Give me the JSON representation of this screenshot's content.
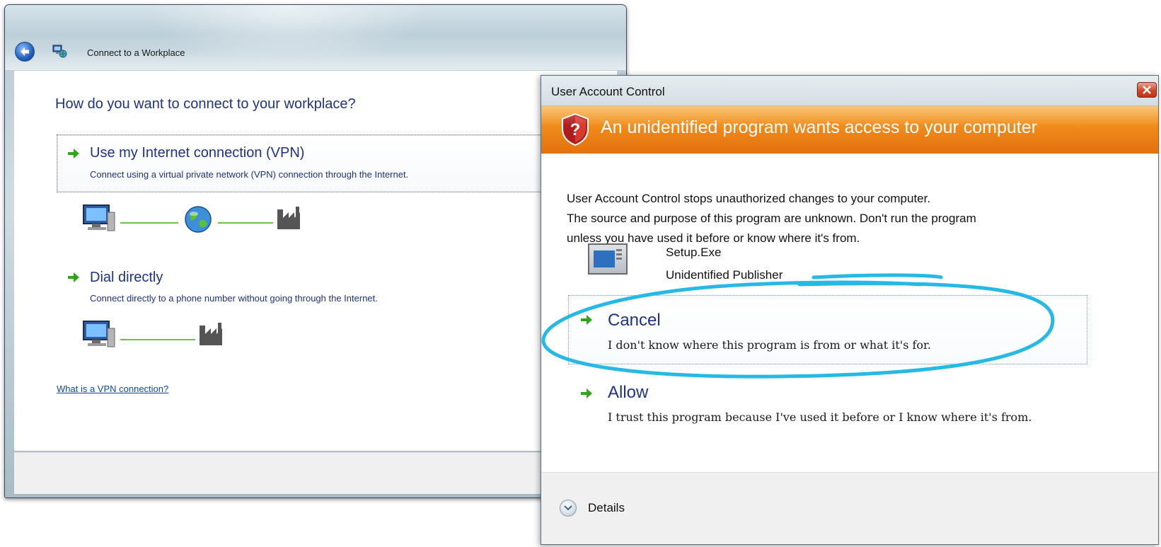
{
  "wizard": {
    "title": "Connect to a Workplace",
    "question": "How do you want to connect to your workplace?",
    "options": [
      {
        "title": "Use my Internet connection (VPN)",
        "description": "Connect using a virtual private network (VPN) connection through the Internet."
      },
      {
        "title": "Dial directly",
        "description": "Connect directly to a phone number without going through the Internet."
      }
    ],
    "help_link": "What is a VPN connection?"
  },
  "uac": {
    "title": "User Account Control",
    "banner": "An unidentified program wants access to your computer",
    "intro_line1": "User Account Control stops unauthorized changes to your computer.",
    "intro_line2": "The source and purpose of this program are unknown.  Don't run the program",
    "intro_line3": "unless you have used it before or know where it's from.",
    "program_name": "Setup.Exe",
    "publisher": "Unidentified Publisher",
    "choices": [
      {
        "title": "Cancel",
        "description": "I don't know where this program is from or what it's for."
      },
      {
        "title": "Allow",
        "description": "I trust this program because I've used it before or I know where it's from."
      }
    ],
    "details_label": "Details"
  },
  "colors": {
    "link_blue": "#1e3287",
    "uac_banner_orange": "#f08a1c",
    "annotation_cyan": "#27b9e6",
    "arrow_green": "#2fa61a"
  },
  "icons": [
    "back-arrow-icon",
    "network-wizard-icon",
    "go-arrow-icon",
    "computer-icon",
    "globe-icon",
    "factory-icon",
    "uac-shield-icon",
    "close-icon",
    "program-icon",
    "chevron-down-icon"
  ]
}
